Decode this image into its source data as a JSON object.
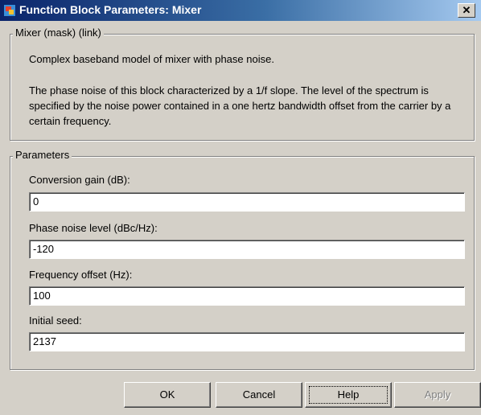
{
  "window": {
    "title": "Function Block Parameters: Mixer",
    "close_label": "✕",
    "app_icon": "simulink-block-icon"
  },
  "description": {
    "group_label": "Mixer (mask) (link)",
    "line1": "Complex baseband model of mixer with phase noise.",
    "para2": "The phase noise of this block characterized by a 1/f slope.  The level of the spectrum is specified by the noise power contained in a one hertz bandwidth offset from the carrier by a certain frequency."
  },
  "parameters": {
    "group_label": "Parameters",
    "fields": [
      {
        "label": "Conversion gain (dB):",
        "value": "0"
      },
      {
        "label": "Phase noise level (dBc/Hz):",
        "value": "-120"
      },
      {
        "label": "Frequency offset (Hz):",
        "value": "100"
      },
      {
        "label": "Initial seed:",
        "value": "2137"
      }
    ]
  },
  "buttons": {
    "ok": "OK",
    "cancel": "Cancel",
    "help": "Help",
    "apply": "Apply"
  }
}
